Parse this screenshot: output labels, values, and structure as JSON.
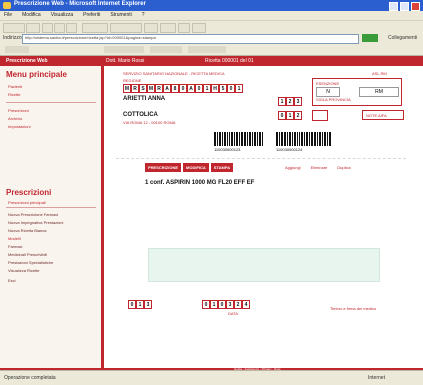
{
  "browser": {
    "window_title": "Prescrizione Web - Microsoft Internet Explorer",
    "menu": [
      "File",
      "Modifica",
      "Visualizza",
      "Preferiti",
      "Strumenti",
      "?"
    ],
    "address_label": "Indirizzo",
    "address_url": "http://sistema.sanita.it/prescrizione/ricetta.jsp?id=000001&pagina=stampa",
    "go_label": "Vai",
    "links_label": "Collegamenti"
  },
  "app_header": {
    "left": "Prescrizione Web",
    "center": "Dott. Mario Rossi",
    "right": "Ricetta 000001 del 01"
  },
  "sidebar": {
    "menu_title": "Menu principale",
    "menu_items": [
      "Pazienti",
      "Ricette"
    ],
    "menu_items2": [
      "Prescrizioni",
      "Archivio",
      "Impostazioni"
    ],
    "presc_title": "Prescrizioni",
    "presc_subtitle": "Prescrizioni principali",
    "presc_items": [
      "Nuova Prescrizione Farmaci",
      "Nuova Impegnativa Prestazioni",
      "Nuova Ricetta Bianca",
      "Modelli",
      "Farmaci",
      "Medicinali Prescrivibili",
      "Prestazioni Specialistiche",
      "Visualizza Ricette",
      "Esci"
    ]
  },
  "document": {
    "header_line": "SERVIZIO SANITARIO NAZIONALE - RICETTA MEDICA",
    "region_label": "REGIONE",
    "right_header": "ASL RM",
    "code_cells": [
      "M",
      "R",
      "S",
      "M",
      "R",
      "A",
      "8",
      "0",
      "A",
      "0",
      "1",
      "H",
      "5",
      "0",
      "1"
    ],
    "patient_name": "ARIETTI ANNA",
    "patient_city": "COTTOLICA",
    "patient_sub": "VIA ROMA 12 - 00100 ROMA",
    "small_cells_top": [
      "1",
      "2",
      "3"
    ],
    "small_cells_bottom": [
      "0",
      "1",
      "2"
    ],
    "right_panel_label": "ESENZIONE",
    "right_panel_code": "N",
    "right_panel_sub": "SIGLA PROVINCIA",
    "right_panel_field": "RM",
    "right_dropdown": "NOTE AIFA",
    "barcode_left": "110030000123",
    "barcode_right": "110030000124"
  },
  "tabs": [
    "PRESCRIZIONE",
    "MODIFICA",
    "STAMPA"
  ],
  "actions": [
    "Aggiungi",
    "Eliminare",
    "Duplica"
  ],
  "prescription_line": "1 conf. ASPIRIN 1000 MG FL20 EFF EF",
  "bottom": {
    "left_cells": [
      "0",
      "1",
      "3"
    ],
    "mid_cells": [
      "0",
      "1",
      "0",
      "3",
      "2",
      "4"
    ],
    "mid_label": "DATA",
    "right_link": "Timbro e firma del medico"
  },
  "footer": {
    "text": "Guida - Assistenza - Privacy - Note"
  },
  "statusbar": {
    "left": "Operazione completata",
    "right": "Internet"
  },
  "colors": {
    "brand_red": "#c0262d",
    "xp_blue": "#2b5fcf",
    "chrome": "#ece9d8",
    "note_green": "#e7f5ee"
  }
}
